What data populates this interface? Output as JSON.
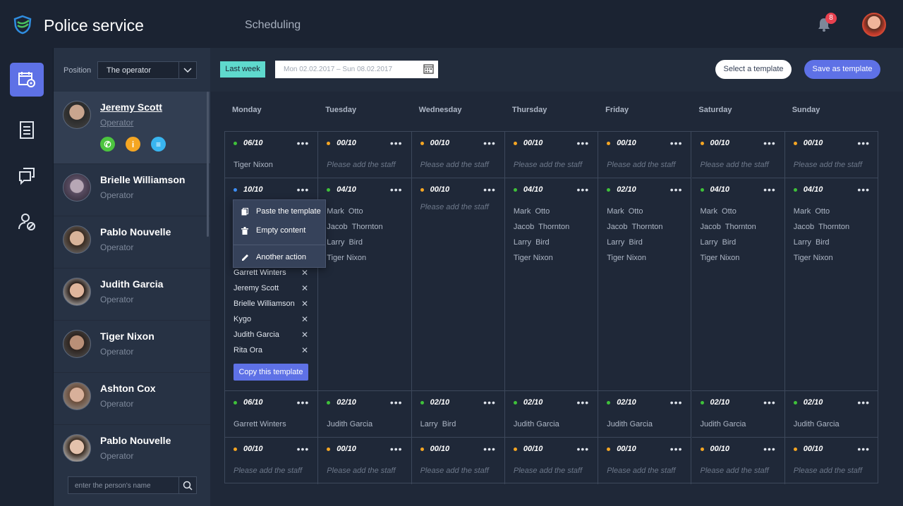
{
  "app": {
    "title": "Police service",
    "page_title": "Scheduling",
    "notification_count": "8"
  },
  "rail": {
    "items": [
      "scheduling",
      "reports",
      "messages",
      "users"
    ]
  },
  "staff_panel": {
    "position_label": "Position",
    "position_value": "The operator",
    "search_placeholder": "enter the person's name",
    "staff": [
      {
        "name": "Jeremy Scott",
        "role": "Operator"
      },
      {
        "name": "Brielle Williamson",
        "role": "Operator"
      },
      {
        "name": "Pablo Nouvelle",
        "role": "Operator"
      },
      {
        "name": "Judith Garcia",
        "role": "Operator"
      },
      {
        "name": "Tiger Nixon",
        "role": "Operator"
      },
      {
        "name": "Ashton Cox",
        "role": "Operator"
      },
      {
        "name": "Pablo Nouvelle",
        "role": "Operator"
      }
    ],
    "action_icons": [
      "phone-icon",
      "info-icon",
      "list-icon"
    ]
  },
  "toolbar": {
    "last_week": "Last week",
    "date_range": "Mon 02.02.2017 – Sun 08.02.2017",
    "select_template": "Select a template",
    "save_template": "Save as template"
  },
  "schedule": {
    "days": [
      "Monday",
      "Tuesday",
      "Wednesday",
      "Thursday",
      "Friday",
      "Saturday",
      "Sunday"
    ],
    "rows": [
      [
        {
          "count": "06/10",
          "status": "green",
          "names": [
            "Tiger Nixon"
          ]
        },
        {
          "count": "00/10",
          "status": "orange",
          "placeholder": "Please add the staff"
        },
        {
          "count": "00/10",
          "status": "orange",
          "placeholder": "Please add the staff"
        },
        {
          "count": "00/10",
          "status": "orange",
          "placeholder": "Please add the staff"
        },
        {
          "count": "00/10",
          "status": "orange",
          "placeholder": "Please add the staff"
        },
        {
          "count": "00/10",
          "status": "orange",
          "placeholder": "Please add the staff"
        },
        {
          "count": "00/10",
          "status": "orange",
          "placeholder": "Please add the staff"
        }
      ],
      [
        {
          "count": "10/10",
          "status": "blue",
          "names": []
        },
        {
          "count": "04/10",
          "status": "green",
          "names": [
            "Mark  Otto",
            "Jacob  Thornton",
            "Larry  Bird",
            "Tiger Nixon"
          ]
        },
        {
          "count": "00/10",
          "status": "orange",
          "placeholder": "Please add the staff"
        },
        {
          "count": "04/10",
          "status": "green",
          "names": [
            "Mark  Otto",
            "Jacob  Thornton",
            "Larry  Bird",
            "Tiger Nixon"
          ]
        },
        {
          "count": "02/10",
          "status": "green",
          "names": [
            "Mark  Otto",
            "Jacob  Thornton",
            "Larry  Bird",
            "Tiger Nixon"
          ]
        },
        {
          "count": "04/10",
          "status": "green",
          "names": [
            "Mark  Otto",
            "Jacob  Thornton",
            "Larry  Bird",
            "Tiger Nixon"
          ]
        },
        {
          "count": "04/10",
          "status": "green",
          "names": [
            "Mark  Otto",
            "Jacob  Thornton",
            "Larry  Bird",
            "Tiger Nixon"
          ]
        }
      ],
      [
        {
          "count": "06/10",
          "status": "green",
          "names": [
            "Garrett Winters"
          ]
        },
        {
          "count": "02/10",
          "status": "green",
          "names": [
            "Judith Garcia"
          ]
        },
        {
          "count": "02/10",
          "status": "green",
          "names": [
            "Larry  Bird"
          ]
        },
        {
          "count": "02/10",
          "status": "green",
          "names": [
            "Judith Garcia"
          ]
        },
        {
          "count": "02/10",
          "status": "green",
          "names": [
            "Judith Garcia"
          ]
        },
        {
          "count": "02/10",
          "status": "green",
          "names": [
            "Judith Garcia"
          ]
        },
        {
          "count": "02/10",
          "status": "green",
          "names": [
            "Judith Garcia"
          ]
        }
      ],
      [
        {
          "count": "00/10",
          "status": "orange",
          "placeholder": "Please add the staff"
        },
        {
          "count": "00/10",
          "status": "orange",
          "placeholder": "Please add the staff"
        },
        {
          "count": "00/10",
          "status": "orange",
          "placeholder": "Please add the staff"
        },
        {
          "count": "00/10",
          "status": "orange",
          "placeholder": "Please add the staff"
        },
        {
          "count": "00/10",
          "status": "orange",
          "placeholder": "Please add the staff"
        },
        {
          "count": "00/10",
          "status": "orange",
          "placeholder": "Please add the staff"
        },
        {
          "count": "00/10",
          "status": "orange",
          "placeholder": "Please add the staff"
        }
      ]
    ]
  },
  "context_menu": {
    "items": [
      {
        "label": "Paste the template",
        "icon": "paste-icon"
      },
      {
        "label": "Empty content",
        "icon": "trash-icon"
      },
      {
        "label": "Another action",
        "icon": "pencil-icon"
      }
    ],
    "assigned": [
      "Garrett Winters",
      "Jeremy Scott",
      "Brielle Williamson",
      "Kygo",
      "Judith Garcia",
      "Rita Ora"
    ],
    "copy_button": "Copy this template"
  },
  "colors": {
    "accent": "#5e71e6",
    "teal": "#5fd9cd",
    "green": "#3fc13a",
    "orange": "#f5a623",
    "blue": "#3d8ef5",
    "badge": "#e8414f"
  }
}
